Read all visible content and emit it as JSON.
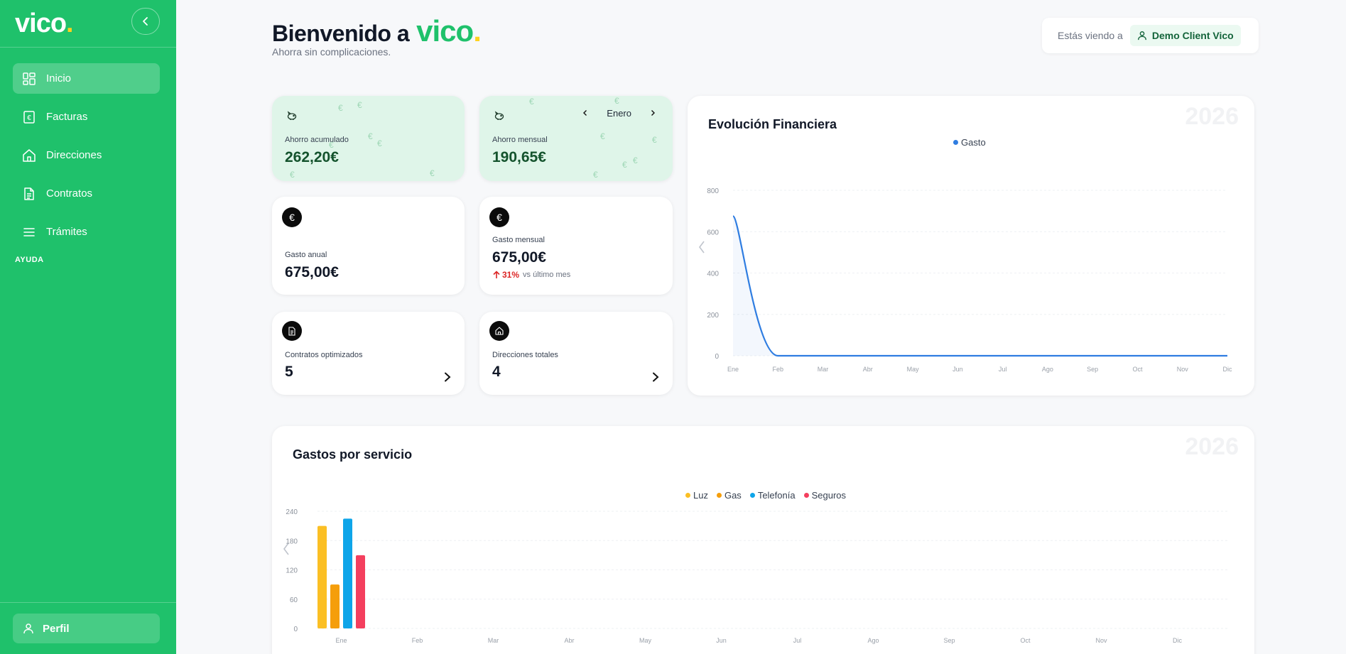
{
  "sidebar": {
    "logo_text": "vico",
    "logo_dot": ".",
    "items": [
      {
        "label": "Inicio",
        "icon": "dashboard-icon",
        "active": true
      },
      {
        "label": "Facturas",
        "icon": "invoice-icon"
      },
      {
        "label": "Direcciones",
        "icon": "home-icon"
      },
      {
        "label": "Contratos",
        "icon": "document-icon"
      },
      {
        "label": "Trámites",
        "icon": "menu-icon"
      }
    ],
    "help_label": "AYUDA",
    "profile_label": "Perfil"
  },
  "header": {
    "welcome_text": "Bienvenido a",
    "brand": "vico",
    "brand_dot": ".",
    "subtitle": "Ahorra sin complicaciones.",
    "viewing_label": "Estás viendo a",
    "client_name": "Demo Client Vico"
  },
  "cards": {
    "ahorro_acumulado": {
      "label": "Ahorro acumulado",
      "value": "262,20€"
    },
    "ahorro_mensual": {
      "label": "Ahorro mensual",
      "value": "190,65€",
      "month": "Enero"
    },
    "gasto_anual": {
      "label": "Gasto anual",
      "value": "675,00€"
    },
    "gasto_mensual": {
      "label": "Gasto mensual",
      "value": "675,00€",
      "trend_pct": "31%",
      "trend_text": "vs último mes"
    },
    "contratos": {
      "label": "Contratos optimizados",
      "value": "5"
    },
    "direcciones": {
      "label": "Direcciones totales",
      "value": "4"
    }
  },
  "colors": {
    "brand_green": "#1fc16b",
    "accent_yellow": "#ffd21f",
    "line_blue": "#2f7de1",
    "luz": "#fbbf24",
    "gas": "#f59e0b",
    "telefonia": "#0ea5e9",
    "seguros": "#f43f5e"
  },
  "chart_data": [
    {
      "type": "line",
      "title": "Evolución Financiera",
      "year": "2026",
      "categories": [
        "Ene",
        "Feb",
        "Mar",
        "Abr",
        "May",
        "Jun",
        "Jul",
        "Ago",
        "Sep",
        "Oct",
        "Nov",
        "Dic"
      ],
      "series": [
        {
          "name": "Gasto",
          "values": [
            675,
            0,
            0,
            0,
            0,
            0,
            0,
            0,
            0,
            0,
            0,
            0
          ]
        }
      ],
      "ylim": [
        0,
        800
      ],
      "yticks": [
        0,
        200,
        400,
        600,
        800
      ],
      "grid": true,
      "legend": "top-center"
    },
    {
      "type": "bar",
      "title": "Gastos por servicio",
      "year": "2026",
      "categories": [
        "Ene",
        "Feb",
        "Mar",
        "Abr",
        "May",
        "Jun",
        "Jul",
        "Ago",
        "Sep",
        "Oct",
        "Nov",
        "Dic"
      ],
      "series": [
        {
          "name": "Luz",
          "values": [
            210,
            0,
            0,
            0,
            0,
            0,
            0,
            0,
            0,
            0,
            0,
            0
          ]
        },
        {
          "name": "Gas",
          "values": [
            90,
            0,
            0,
            0,
            0,
            0,
            0,
            0,
            0,
            0,
            0,
            0
          ]
        },
        {
          "name": "Telefonía",
          "values": [
            225,
            0,
            0,
            0,
            0,
            0,
            0,
            0,
            0,
            0,
            0,
            0
          ]
        },
        {
          "name": "Seguros",
          "values": [
            150,
            0,
            0,
            0,
            0,
            0,
            0,
            0,
            0,
            0,
            0,
            0
          ]
        }
      ],
      "ylim": [
        0,
        240
      ],
      "yticks": [
        0,
        60,
        120,
        180,
        240
      ],
      "grid": true,
      "legend": "top-center"
    }
  ]
}
